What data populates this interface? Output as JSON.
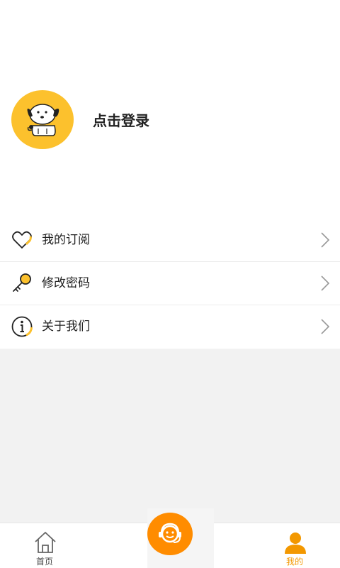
{
  "profile": {
    "login_label": "点击登录"
  },
  "menu": {
    "items": [
      {
        "label": "我的订阅",
        "icon": "heart-icon"
      },
      {
        "label": "修改密码",
        "icon": "key-icon"
      },
      {
        "label": "关于我们",
        "icon": "info-icon"
      }
    ]
  },
  "tabbar": {
    "home_label": "首页",
    "mine_label": "我的",
    "center_icon": "customer-service-icon"
  },
  "colors": {
    "accent": "#f39800",
    "avatar_bg": "#fcc12d",
    "center_button": "#ff8c00"
  }
}
